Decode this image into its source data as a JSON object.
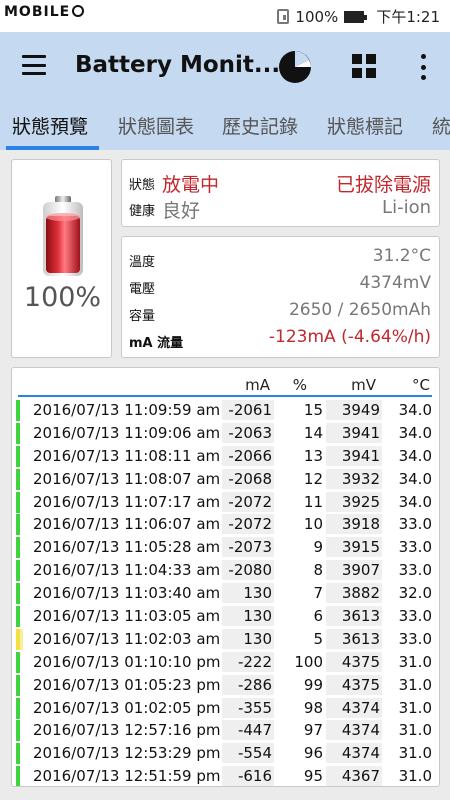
{
  "status_bar": {
    "brand": "MOBILE",
    "battery_percent": "100%",
    "time": "下午1:21"
  },
  "app_bar": {
    "title": "Battery Monit...",
    "icons": [
      "menu-icon",
      "pie-chart-icon",
      "grid-icon",
      "more-vert-icon"
    ]
  },
  "tabs": [
    {
      "label": "狀態預覽",
      "active": true
    },
    {
      "label": "狀態圖表",
      "active": false
    },
    {
      "label": "歷史記錄",
      "active": false
    },
    {
      "label": "狀態標記",
      "active": false
    },
    {
      "label": "統",
      "active": false
    }
  ],
  "battery": {
    "percent": "100%",
    "level": 1.0
  },
  "status": {
    "state_label": "狀態",
    "state_value": "放電中",
    "state_right": "已拔除電源",
    "health_label": "健康",
    "health_value": "良好",
    "health_right": "Li-ion"
  },
  "info": {
    "temp_label": "溫度",
    "temp_value": "31.2°C",
    "voltage_label": "電壓",
    "voltage_value": "4374mV",
    "capacity_label": "容量",
    "capacity_value": "2650 / 2650mAh",
    "current_label": "mA 流量",
    "current_value": "-123mA (-4.64%/h)"
  },
  "table": {
    "headers": {
      "ma": "mA",
      "pct": "%",
      "mv": "mV",
      "temp": "°C"
    },
    "rows": [
      {
        "date": "2016/07/13 11:09:59 am",
        "ma": "-2061",
        "pct": "15",
        "mv": "3949",
        "temp": "34.0",
        "bar": "green"
      },
      {
        "date": "2016/07/13 11:09:06 am",
        "ma": "-2063",
        "pct": "14",
        "mv": "3941",
        "temp": "34.0",
        "bar": "green"
      },
      {
        "date": "2016/07/13 11:08:11 am",
        "ma": "-2066",
        "pct": "13",
        "mv": "3941",
        "temp": "34.0",
        "bar": "green"
      },
      {
        "date": "2016/07/13 11:08:07 am",
        "ma": "-2068",
        "pct": "12",
        "mv": "3932",
        "temp": "34.0",
        "bar": "green"
      },
      {
        "date": "2016/07/13 11:07:17 am",
        "ma": "-2072",
        "pct": "11",
        "mv": "3925",
        "temp": "34.0",
        "bar": "green"
      },
      {
        "date": "2016/07/13 11:06:07 am",
        "ma": "-2072",
        "pct": "10",
        "mv": "3918",
        "temp": "33.0",
        "bar": "green"
      },
      {
        "date": "2016/07/13 11:05:28 am",
        "ma": "-2073",
        "pct": "9",
        "mv": "3915",
        "temp": "33.0",
        "bar": "green"
      },
      {
        "date": "2016/07/13 11:04:33 am",
        "ma": "-2080",
        "pct": "8",
        "mv": "3907",
        "temp": "33.0",
        "bar": "green"
      },
      {
        "date": "2016/07/13 11:03:40 am",
        "ma": "130",
        "pct": "7",
        "mv": "3882",
        "temp": "32.0",
        "bar": "green"
      },
      {
        "date": "2016/07/13 11:03:05 am",
        "ma": "130",
        "pct": "6",
        "mv": "3613",
        "temp": "33.0",
        "bar": "green"
      },
      {
        "date": "2016/07/13 11:02:03 am",
        "ma": "130",
        "pct": "5",
        "mv": "3613",
        "temp": "33.0",
        "bar": "yellow"
      },
      {
        "date": "2016/07/13 01:10:10 pm",
        "ma": "-222",
        "pct": "100",
        "mv": "4375",
        "temp": "31.0",
        "bar": "green"
      },
      {
        "date": "2016/07/13 01:05:23 pm",
        "ma": "-286",
        "pct": "99",
        "mv": "4375",
        "temp": "31.0",
        "bar": "green"
      },
      {
        "date": "2016/07/13 01:02:05 pm",
        "ma": "-355",
        "pct": "98",
        "mv": "4374",
        "temp": "31.0",
        "bar": "green"
      },
      {
        "date": "2016/07/13 12:57:16 pm",
        "ma": "-447",
        "pct": "97",
        "mv": "4374",
        "temp": "31.0",
        "bar": "green"
      },
      {
        "date": "2016/07/13 12:53:29 pm",
        "ma": "-554",
        "pct": "96",
        "mv": "4374",
        "temp": "31.0",
        "bar": "green"
      },
      {
        "date": "2016/07/13 12:51:59 pm",
        "ma": "-616",
        "pct": "95",
        "mv": "4367",
        "temp": "31.0",
        "bar": "green"
      }
    ]
  },
  "colors": {
    "app_bar": "#c5d9f0",
    "accent": "#2a82e8",
    "discharge_red": "#c0282e",
    "bar_green": "#3fd33f",
    "bar_yellow": "#f3e23d"
  }
}
